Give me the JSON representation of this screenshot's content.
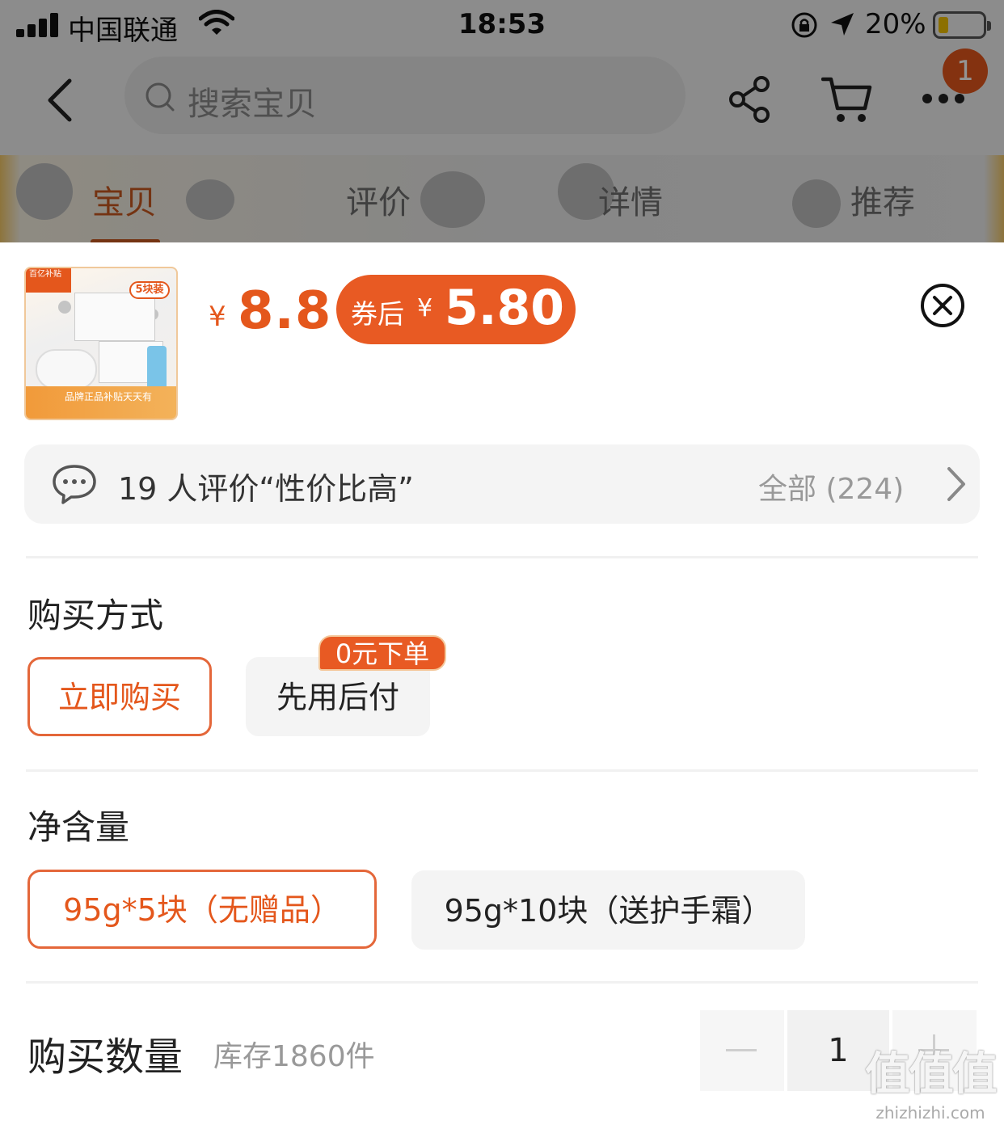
{
  "status_bar": {
    "carrier": "中国联通",
    "time": "18:53",
    "battery_percent": "20%"
  },
  "nav": {
    "search_placeholder": "搜索宝贝",
    "notification_count": "1"
  },
  "tabs": [
    {
      "label": "宝贝",
      "active": true
    },
    {
      "label": "评价",
      "active": false
    },
    {
      "label": "详情",
      "active": false
    },
    {
      "label": "推荐",
      "active": false
    }
  ],
  "product": {
    "thumb_badge": "5块装",
    "thumb_corner": "百亿补贴",
    "thumb_strip": "品牌正品补贴天天有",
    "currency": "¥",
    "price": "8.8",
    "coupon_label": "券后",
    "coupon_currency": "¥",
    "coupon_price": "5.80"
  },
  "review": {
    "text": "19 人评价“性价比高”",
    "all_label": "全部 (224)"
  },
  "purchase_method": {
    "title": "购买方式",
    "options": [
      {
        "label": "立即购买",
        "selected": true
      },
      {
        "label": "先用后付",
        "selected": false,
        "badge": "0元下单"
      }
    ]
  },
  "net_content": {
    "title": "净含量",
    "options": [
      {
        "label": "95g*5块（无赠品）",
        "selected": true
      },
      {
        "label": "95g*10块（送护手霜）",
        "selected": false
      }
    ]
  },
  "quantity": {
    "title": "购买数量",
    "stock": "库存1860件",
    "value": "1"
  },
  "watermark": {
    "main": "值值值",
    "domain": "zhizhizhi.com"
  },
  "colors": {
    "accent": "#e4571c",
    "coupon_bg": "#e85a23"
  }
}
